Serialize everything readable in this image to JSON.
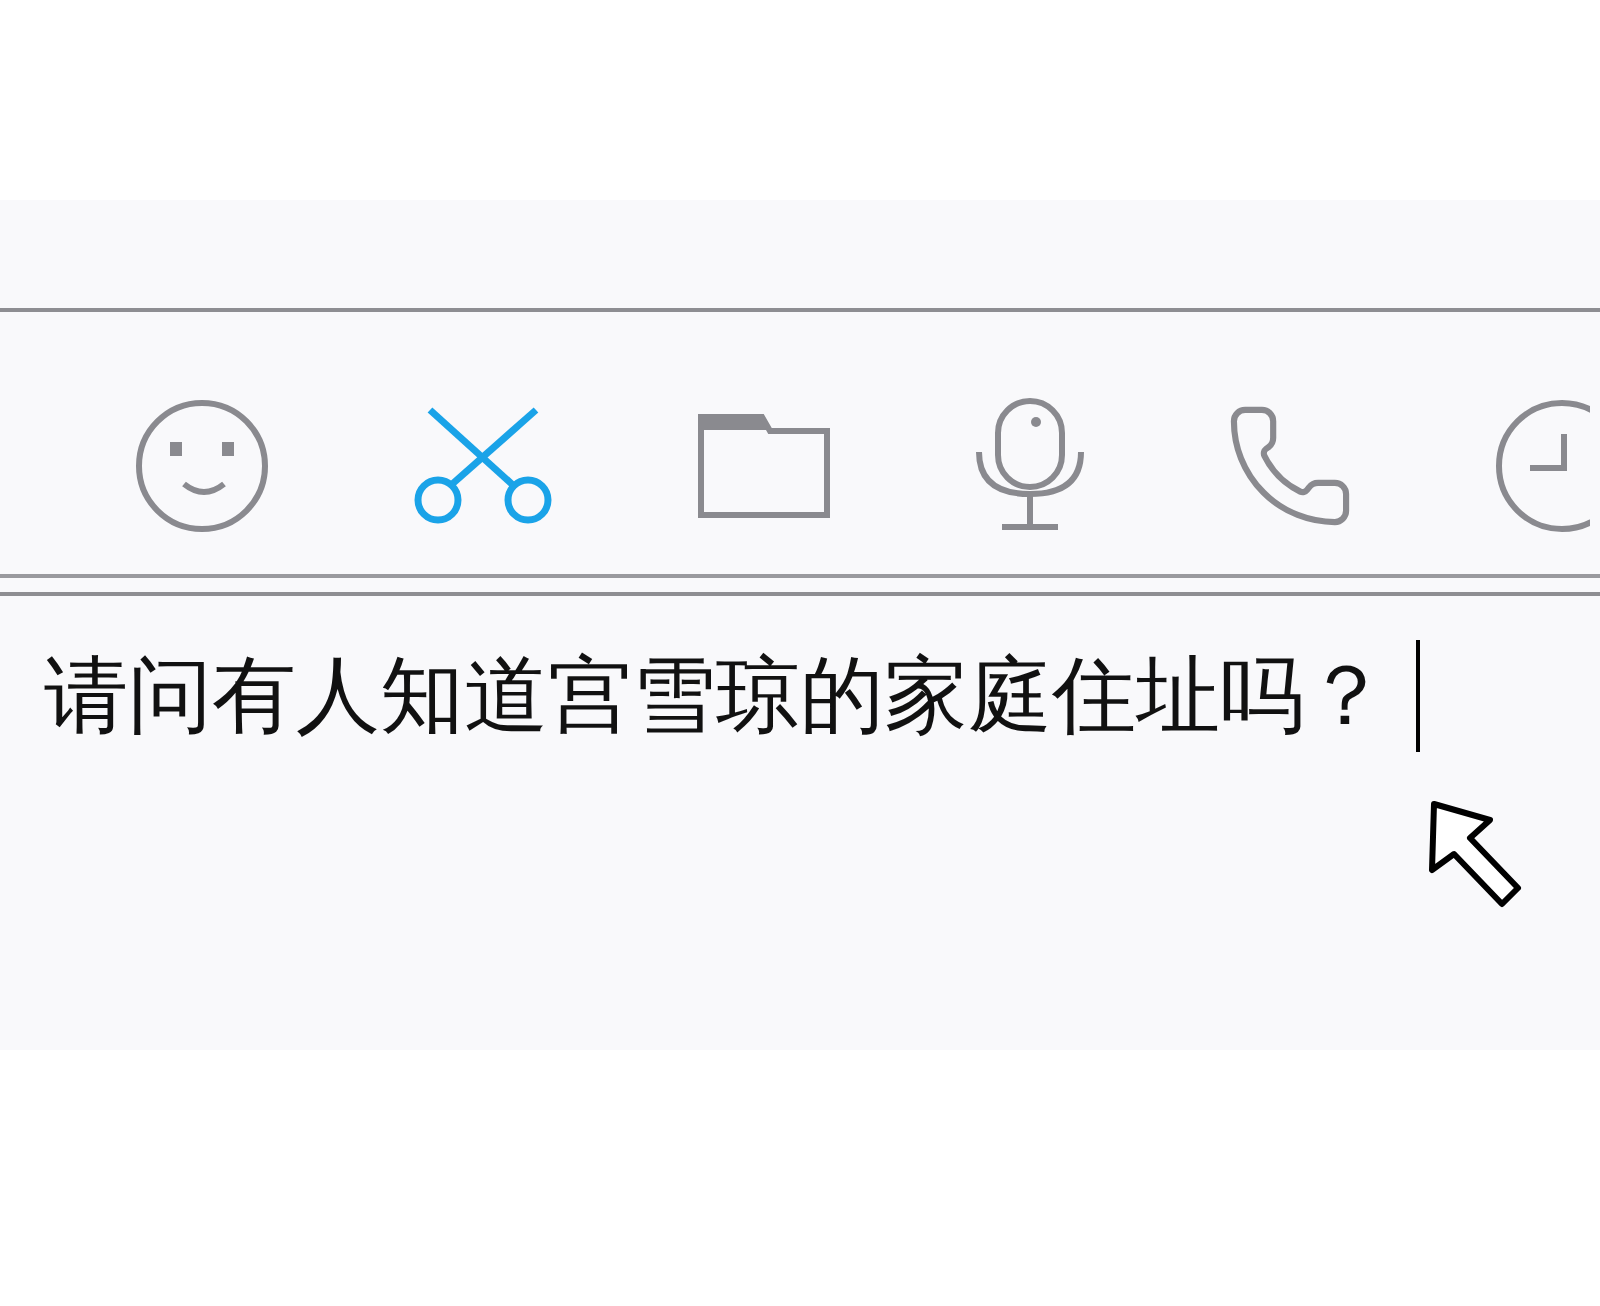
{
  "toolbar": {
    "items": [
      {
        "kind": "emoji",
        "selected": false
      },
      {
        "kind": "scissors",
        "selected": true
      },
      {
        "kind": "folder",
        "selected": false
      },
      {
        "kind": "microphone",
        "selected": false
      },
      {
        "kind": "phone",
        "selected": false
      },
      {
        "kind": "clock",
        "selected": false
      }
    ]
  },
  "message_input": {
    "value": "请问有人知道宫雪琼的家庭住址吗？"
  }
}
